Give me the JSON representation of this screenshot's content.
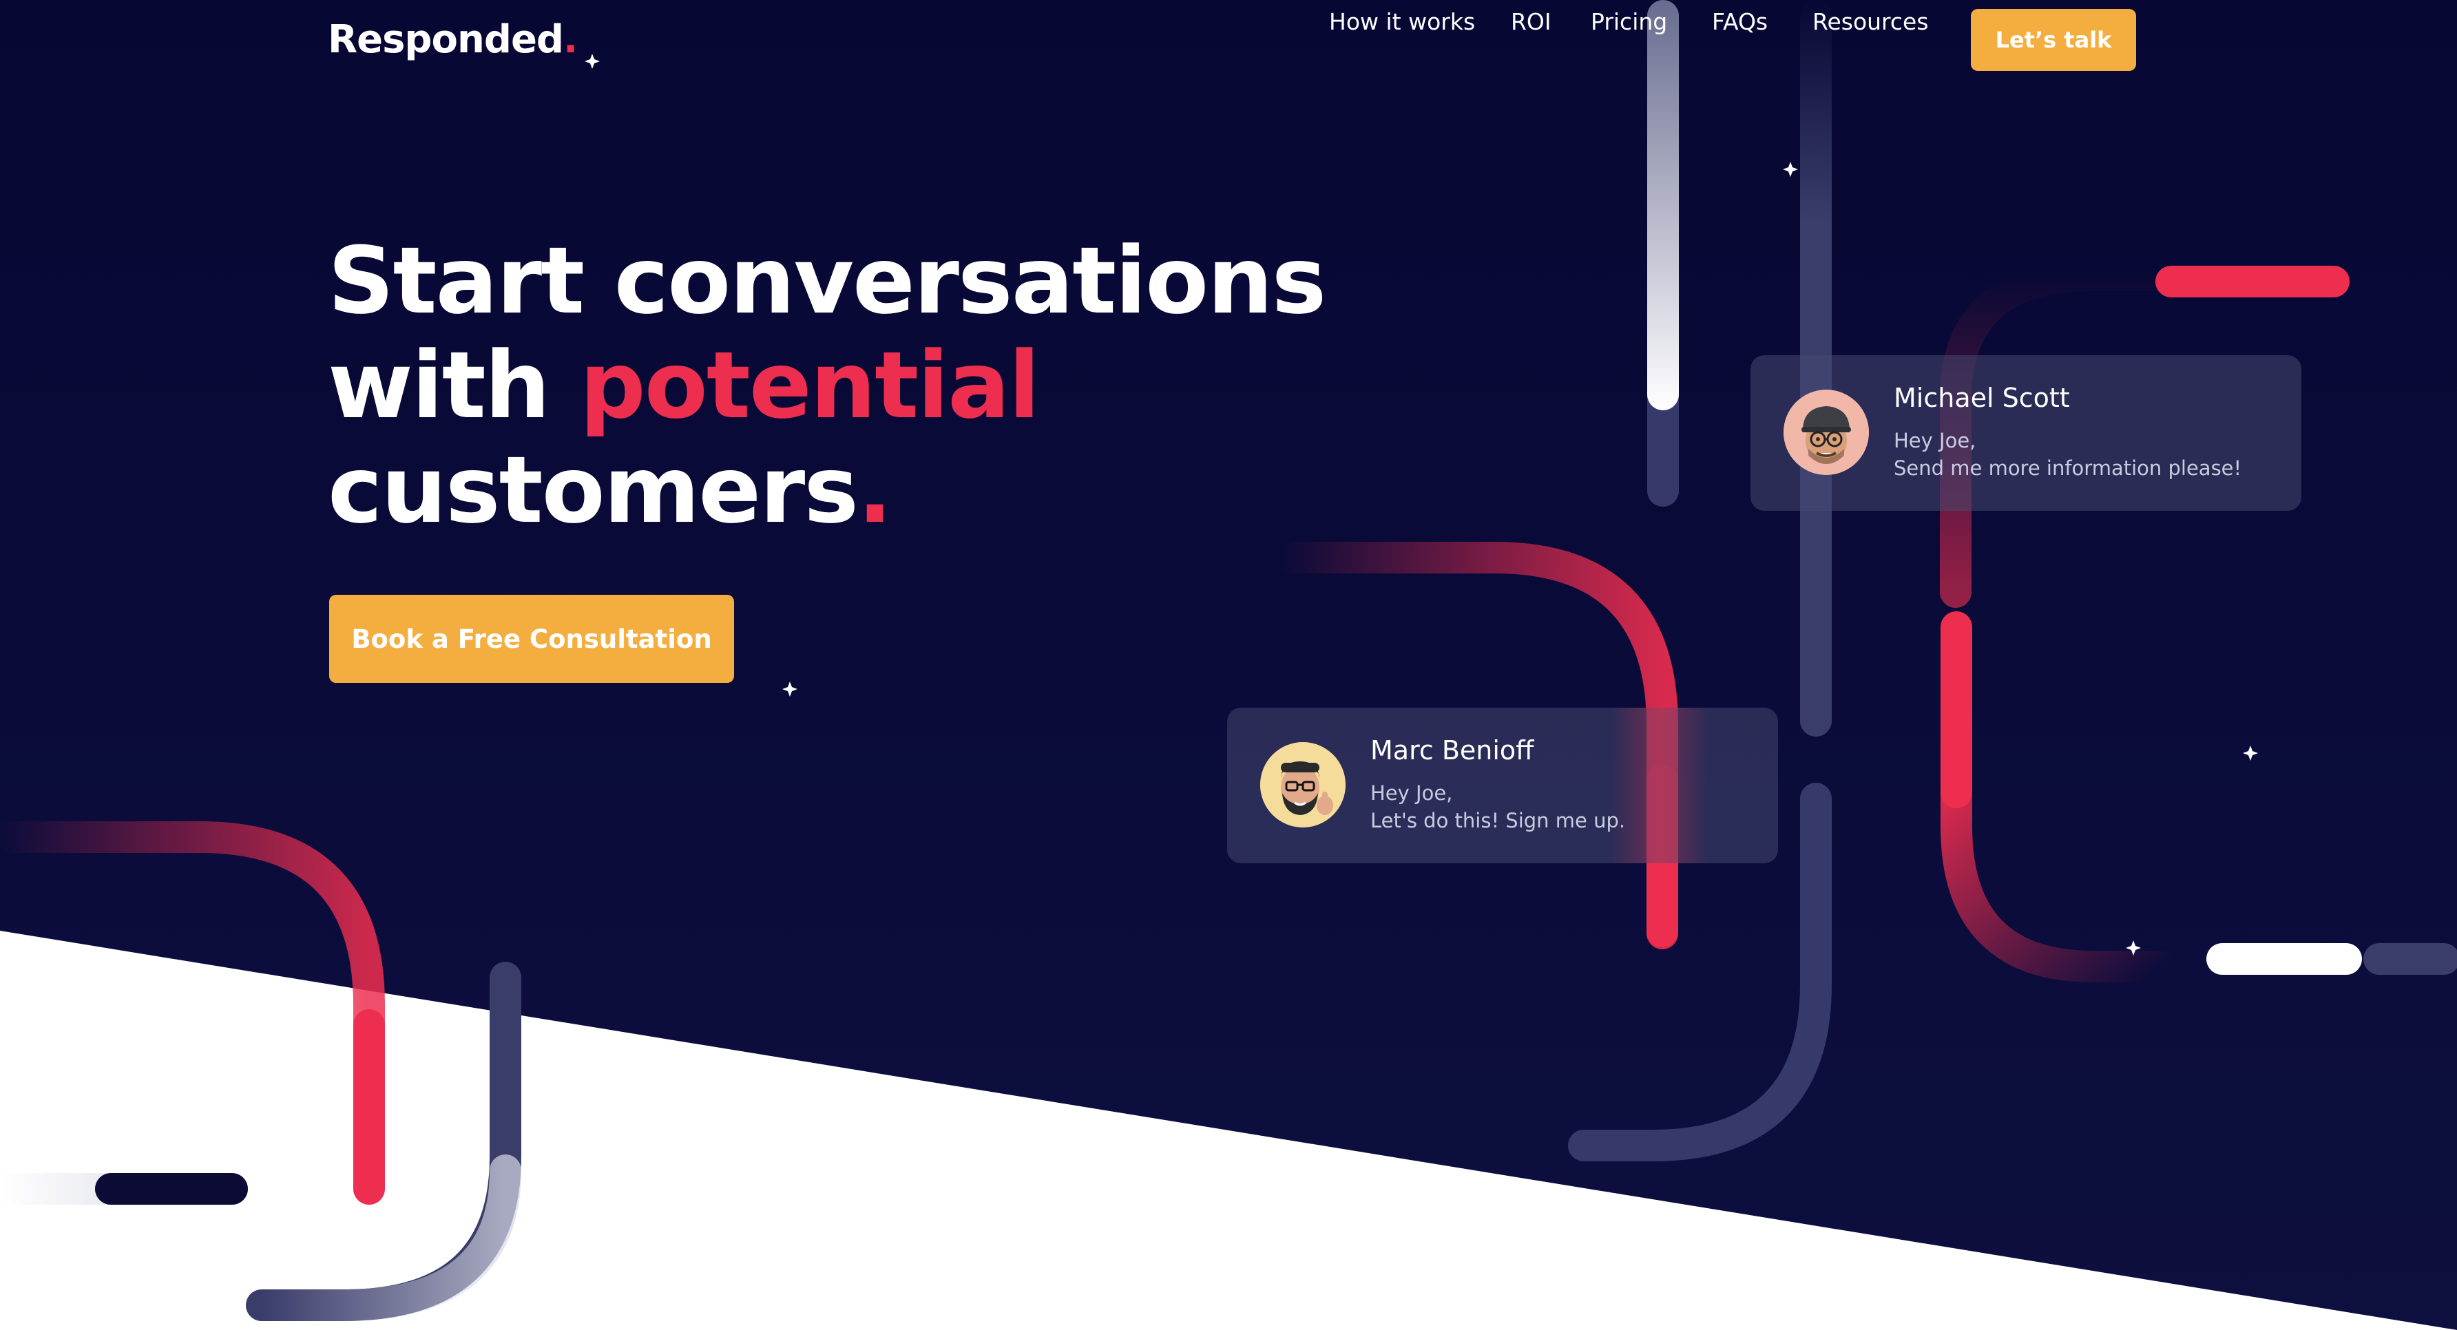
{
  "brand": {
    "name": "Responded",
    "dot": "."
  },
  "nav": {
    "items": [
      {
        "label": "How it works"
      },
      {
        "label": "ROI"
      },
      {
        "label": "Pricing"
      },
      {
        "label": "FAQs"
      },
      {
        "label": "Resources"
      }
    ],
    "cta_label": "Let’s talk"
  },
  "hero": {
    "line1": "Start conversations",
    "line2_prefix": "with ",
    "line2_accent": "potential",
    "line3": "customers",
    "line3_dot": ".",
    "cta_label": "Book a Free Consultation"
  },
  "messages": [
    {
      "name": "Michael Scott",
      "greeting": "Hey Joe,",
      "body": "Send me more information please!",
      "avatar_icon": "memoji-man-cap-glasses-icon"
    },
    {
      "name": "Marc Benioff",
      "greeting": "Hey Joe,",
      "body": "Let's do this! Sign me up.",
      "avatar_icon": "memoji-man-beard-thumbsup-icon"
    }
  ],
  "colors": {
    "background": "#0b0b35",
    "accent_red": "#ee2e4f",
    "cta_orange": "#f4ae3f",
    "white": "#ffffff"
  }
}
